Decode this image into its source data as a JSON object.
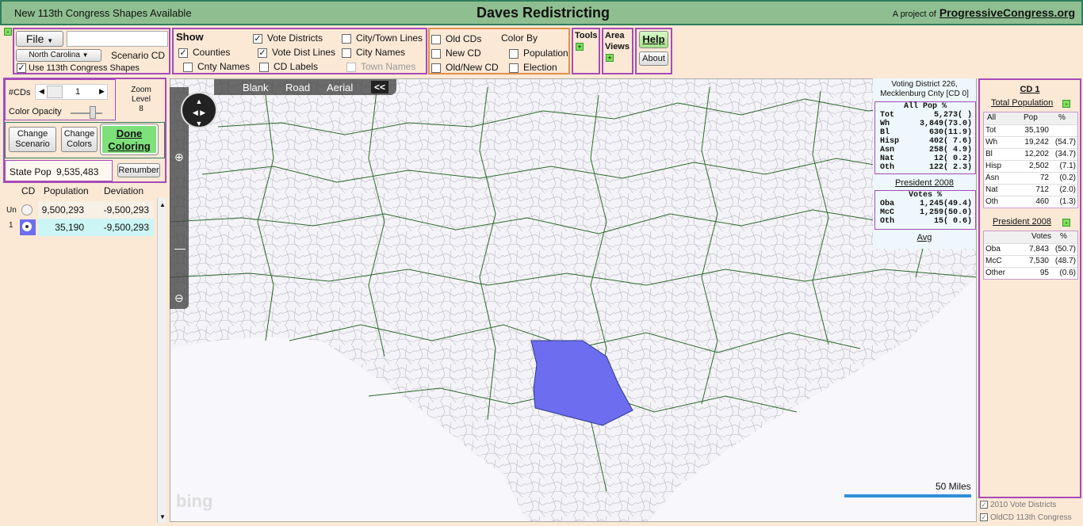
{
  "titlebar": {
    "left": "New 113th Congress Shapes Available",
    "center": "Daves Redistricting",
    "right_prefix": "A project of",
    "right_link": "ProgressiveCongress.org"
  },
  "toolbar": {
    "collapse": "-",
    "file": "File",
    "state": "North Carolina",
    "scenario": "Scenario CD",
    "use_113": "Use 113th Congress Shapes",
    "show_label": "Show",
    "counties": "Counties",
    "cnty_names": "Cnty Names",
    "vote_districts": "Vote Districts",
    "vote_dist_lines": "Vote Dist Lines",
    "cd_labels": "CD Labels",
    "city_town_lines": "City/Town Lines",
    "city_names": "City Names",
    "town_names": "Town Names",
    "old_cds": "Old CDs",
    "new_cd": "New CD",
    "old_new_cd": "Old/New CD",
    "color_by": "Color By",
    "population": "Population",
    "election": "Election",
    "tools": "Tools",
    "area_views_1": "Area",
    "area_views_2": "Views",
    "help": "Help",
    "about": "About"
  },
  "left": {
    "num_cds_label": "#CDs",
    "num_cds": "1",
    "zoom_label_1": "Zoom",
    "zoom_label_2": "Level",
    "zoom_level": "8",
    "opacity_label": "Color Opacity",
    "change_scenario_1": "Change",
    "change_scenario_2": "Scenario",
    "change_colors_1": "Change",
    "change_colors_2": "Colors",
    "done_1": "Done",
    "done_2": "Coloring",
    "state_pop_label": "State Pop",
    "state_pop": "9,535,483",
    "renumber": "Renumber",
    "col_cd": "CD",
    "col_pop": "Population",
    "col_dev": "Deviation",
    "rows": [
      {
        "cd": "Un",
        "pop": "9,500,293",
        "dev": "-9,500,293"
      },
      {
        "cd": "1",
        "pop": "35,190",
        "dev": "-9,500,293"
      }
    ]
  },
  "map": {
    "tabs": [
      "Blank",
      "Road",
      "Aerial"
    ],
    "collapse": "<<",
    "scale": "50 Miles",
    "bing": "bing",
    "fill_color": "#6d6df0"
  },
  "vd": {
    "title_1": "Voting District 226,",
    "title_2": "Mecklenburg Cnty [CD 0]",
    "pop_hdr": "All Pop    %",
    "pop_rows": [
      [
        "Tot",
        "5,273(    )"
      ],
      [
        "Wh",
        "3,849(73.0)"
      ],
      [
        "Bl",
        "630(11.9)"
      ],
      [
        "Hisp",
        "402( 7.6)"
      ],
      [
        "Asn",
        "258( 4.9)"
      ],
      [
        "Nat",
        "12( 0.2)"
      ],
      [
        "Oth",
        "122( 2.3)"
      ]
    ],
    "pres_label": "President 2008",
    "votes_hdr": "Votes     %",
    "vote_rows": [
      [
        "Oba",
        "1,245(49.4)"
      ],
      [
        "McC",
        "1,259(50.0)"
      ],
      [
        "Oth",
        "15( 0.6)"
      ]
    ],
    "avg": "Avg"
  },
  "cd": {
    "title": "CD 1",
    "total_pop": "Total Population",
    "hdr": [
      "All",
      "Pop",
      "%"
    ],
    "rows": [
      [
        "Tot",
        "35,190",
        ""
      ],
      [
        "Wh",
        "19,242",
        "(54.7)"
      ],
      [
        "Bl",
        "12,202",
        "(34.7)"
      ],
      [
        "Hisp",
        "2,502",
        "(7.1)"
      ],
      [
        "Asn",
        "72",
        "(0.2)"
      ],
      [
        "Nat",
        "712",
        "(2.0)"
      ],
      [
        "Oth",
        "460",
        "(1.3)"
      ]
    ],
    "pres": "President 2008",
    "vhdr": [
      "Votes",
      "%"
    ],
    "vrows": [
      [
        "Oba",
        "7,843",
        "(50.7)"
      ],
      [
        "McC",
        "7,530",
        "(48.7)"
      ],
      [
        "Other",
        "95",
        "(0.6)"
      ]
    ]
  },
  "footer": {
    "vote_districts_2010": "2010 Vote Districts",
    "oldcd": "OldCD 113th Congress"
  }
}
